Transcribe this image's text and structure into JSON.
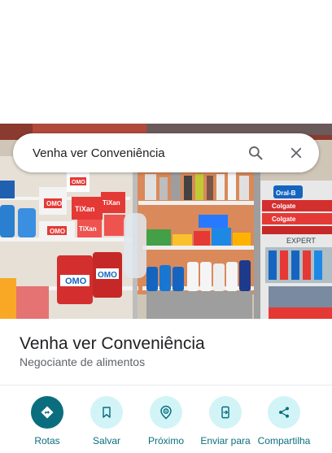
{
  "search": {
    "query": "Venha ver Conveniência"
  },
  "icons": {
    "search": "search-icon",
    "close": "close-icon",
    "directions": "directions-icon",
    "save": "bookmark-icon",
    "nearby": "nearby-icon",
    "send_to_phone": "send-to-phone-icon",
    "share": "share-icon"
  },
  "place": {
    "name": "Venha ver Conveniência",
    "category": "Negociante de alimentos"
  },
  "actions": [
    {
      "label": "Rotas"
    },
    {
      "label": "Salvar"
    },
    {
      "label": "Próximo"
    },
    {
      "label": "Enviar para"
    },
    {
      "label": "Compartilha"
    }
  ],
  "photo": {
    "product_labels": [
      "OMO",
      "OMO",
      "OMO",
      "OMO",
      "OMO",
      "TiXan",
      "TiXan",
      "TiXan",
      "Oral-B",
      "Colgate",
      "Colgate",
      "EXPERT"
    ]
  },
  "colors": {
    "accent": "#0b6e7f",
    "accent_light": "#d2f4f7"
  }
}
